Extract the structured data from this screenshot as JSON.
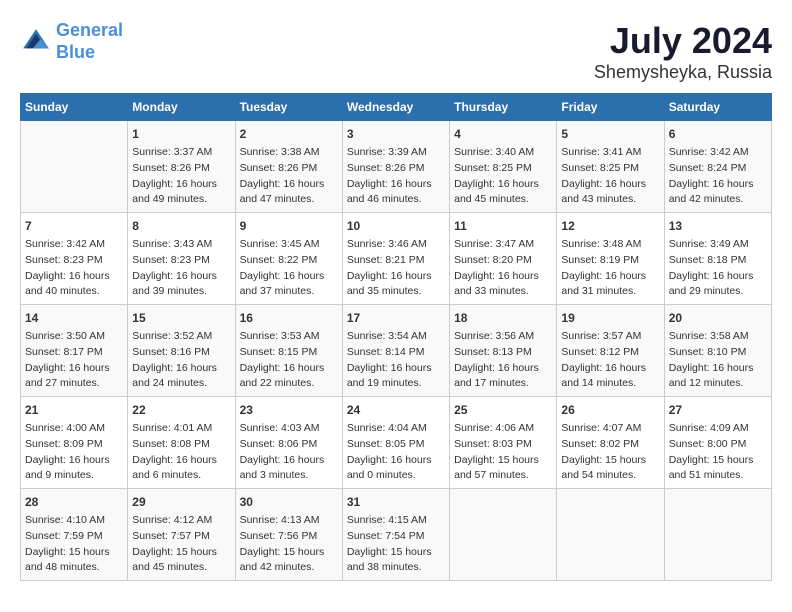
{
  "header": {
    "logo_line1": "General",
    "logo_line2": "Blue",
    "month": "July 2024",
    "location": "Shemysheyka, Russia"
  },
  "days_of_week": [
    "Sunday",
    "Monday",
    "Tuesday",
    "Wednesday",
    "Thursday",
    "Friday",
    "Saturday"
  ],
  "weeks": [
    [
      {
        "day": "",
        "content": ""
      },
      {
        "day": "1",
        "content": "Sunrise: 3:37 AM\nSunset: 8:26 PM\nDaylight: 16 hours\nand 49 minutes."
      },
      {
        "day": "2",
        "content": "Sunrise: 3:38 AM\nSunset: 8:26 PM\nDaylight: 16 hours\nand 47 minutes."
      },
      {
        "day": "3",
        "content": "Sunrise: 3:39 AM\nSunset: 8:26 PM\nDaylight: 16 hours\nand 46 minutes."
      },
      {
        "day": "4",
        "content": "Sunrise: 3:40 AM\nSunset: 8:25 PM\nDaylight: 16 hours\nand 45 minutes."
      },
      {
        "day": "5",
        "content": "Sunrise: 3:41 AM\nSunset: 8:25 PM\nDaylight: 16 hours\nand 43 minutes."
      },
      {
        "day": "6",
        "content": "Sunrise: 3:42 AM\nSunset: 8:24 PM\nDaylight: 16 hours\nand 42 minutes."
      }
    ],
    [
      {
        "day": "7",
        "content": "Sunrise: 3:42 AM\nSunset: 8:23 PM\nDaylight: 16 hours\nand 40 minutes."
      },
      {
        "day": "8",
        "content": "Sunrise: 3:43 AM\nSunset: 8:23 PM\nDaylight: 16 hours\nand 39 minutes."
      },
      {
        "day": "9",
        "content": "Sunrise: 3:45 AM\nSunset: 8:22 PM\nDaylight: 16 hours\nand 37 minutes."
      },
      {
        "day": "10",
        "content": "Sunrise: 3:46 AM\nSunset: 8:21 PM\nDaylight: 16 hours\nand 35 minutes."
      },
      {
        "day": "11",
        "content": "Sunrise: 3:47 AM\nSunset: 8:20 PM\nDaylight: 16 hours\nand 33 minutes."
      },
      {
        "day": "12",
        "content": "Sunrise: 3:48 AM\nSunset: 8:19 PM\nDaylight: 16 hours\nand 31 minutes."
      },
      {
        "day": "13",
        "content": "Sunrise: 3:49 AM\nSunset: 8:18 PM\nDaylight: 16 hours\nand 29 minutes."
      }
    ],
    [
      {
        "day": "14",
        "content": "Sunrise: 3:50 AM\nSunset: 8:17 PM\nDaylight: 16 hours\nand 27 minutes."
      },
      {
        "day": "15",
        "content": "Sunrise: 3:52 AM\nSunset: 8:16 PM\nDaylight: 16 hours\nand 24 minutes."
      },
      {
        "day": "16",
        "content": "Sunrise: 3:53 AM\nSunset: 8:15 PM\nDaylight: 16 hours\nand 22 minutes."
      },
      {
        "day": "17",
        "content": "Sunrise: 3:54 AM\nSunset: 8:14 PM\nDaylight: 16 hours\nand 19 minutes."
      },
      {
        "day": "18",
        "content": "Sunrise: 3:56 AM\nSunset: 8:13 PM\nDaylight: 16 hours\nand 17 minutes."
      },
      {
        "day": "19",
        "content": "Sunrise: 3:57 AM\nSunset: 8:12 PM\nDaylight: 16 hours\nand 14 minutes."
      },
      {
        "day": "20",
        "content": "Sunrise: 3:58 AM\nSunset: 8:10 PM\nDaylight: 16 hours\nand 12 minutes."
      }
    ],
    [
      {
        "day": "21",
        "content": "Sunrise: 4:00 AM\nSunset: 8:09 PM\nDaylight: 16 hours\nand 9 minutes."
      },
      {
        "day": "22",
        "content": "Sunrise: 4:01 AM\nSunset: 8:08 PM\nDaylight: 16 hours\nand 6 minutes."
      },
      {
        "day": "23",
        "content": "Sunrise: 4:03 AM\nSunset: 8:06 PM\nDaylight: 16 hours\nand 3 minutes."
      },
      {
        "day": "24",
        "content": "Sunrise: 4:04 AM\nSunset: 8:05 PM\nDaylight: 16 hours\nand 0 minutes."
      },
      {
        "day": "25",
        "content": "Sunrise: 4:06 AM\nSunset: 8:03 PM\nDaylight: 15 hours\nand 57 minutes."
      },
      {
        "day": "26",
        "content": "Sunrise: 4:07 AM\nSunset: 8:02 PM\nDaylight: 15 hours\nand 54 minutes."
      },
      {
        "day": "27",
        "content": "Sunrise: 4:09 AM\nSunset: 8:00 PM\nDaylight: 15 hours\nand 51 minutes."
      }
    ],
    [
      {
        "day": "28",
        "content": "Sunrise: 4:10 AM\nSunset: 7:59 PM\nDaylight: 15 hours\nand 48 minutes."
      },
      {
        "day": "29",
        "content": "Sunrise: 4:12 AM\nSunset: 7:57 PM\nDaylight: 15 hours\nand 45 minutes."
      },
      {
        "day": "30",
        "content": "Sunrise: 4:13 AM\nSunset: 7:56 PM\nDaylight: 15 hours\nand 42 minutes."
      },
      {
        "day": "31",
        "content": "Sunrise: 4:15 AM\nSunset: 7:54 PM\nDaylight: 15 hours\nand 38 minutes."
      },
      {
        "day": "",
        "content": ""
      },
      {
        "day": "",
        "content": ""
      },
      {
        "day": "",
        "content": ""
      }
    ]
  ]
}
